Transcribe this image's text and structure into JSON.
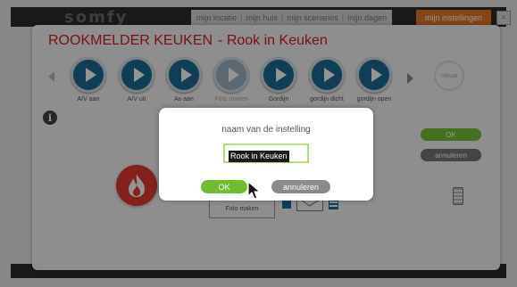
{
  "header": {
    "logo": "somfy",
    "nav": [
      "mijn locatie",
      "mijn huis",
      "mijn scenarios",
      "mijn dagen"
    ],
    "orange_label": "mijn instellingen",
    "close_symbol": "×"
  },
  "panel": {
    "title": "ROOKMELDER KEUKEN",
    "subtitle": "- Rook in Keuken",
    "scenarios": [
      {
        "label": "A/V aan",
        "enabled": true
      },
      {
        "label": "A/V uit",
        "enabled": true
      },
      {
        "label": "Av aan",
        "enabled": true
      },
      {
        "label": "Foto maken",
        "enabled": false
      },
      {
        "label": "Gordijn",
        "enabled": true
      },
      {
        "label": "gordijn dicht",
        "enabled": true
      },
      {
        "label": "gordijn open",
        "enabled": true
      }
    ],
    "new_label": "nieuw",
    "info_symbol": "i",
    "ok_label": "OK",
    "cancel_label": "annuleren",
    "photo_label": "Foto maken",
    "mini_icon_a": "A"
  },
  "dialog": {
    "title": "naam van de instelling",
    "input_value": "Rook in Keuken",
    "ok_label": "OK",
    "cancel_label": "annuleren"
  },
  "colors": {
    "accent_red": "#d0202a",
    "scenario_blue": "#1c6b93",
    "ok_green": "#72bb2d",
    "cancel_gray": "#8a8a8a"
  },
  "icons": {
    "prev": "chevron-left-icon",
    "next": "chevron-right-icon",
    "scenario": "play-icon",
    "info": "info-icon",
    "device": "flame-icon",
    "battery": "battery-icon",
    "cursor": "mouse-pointer-icon"
  }
}
